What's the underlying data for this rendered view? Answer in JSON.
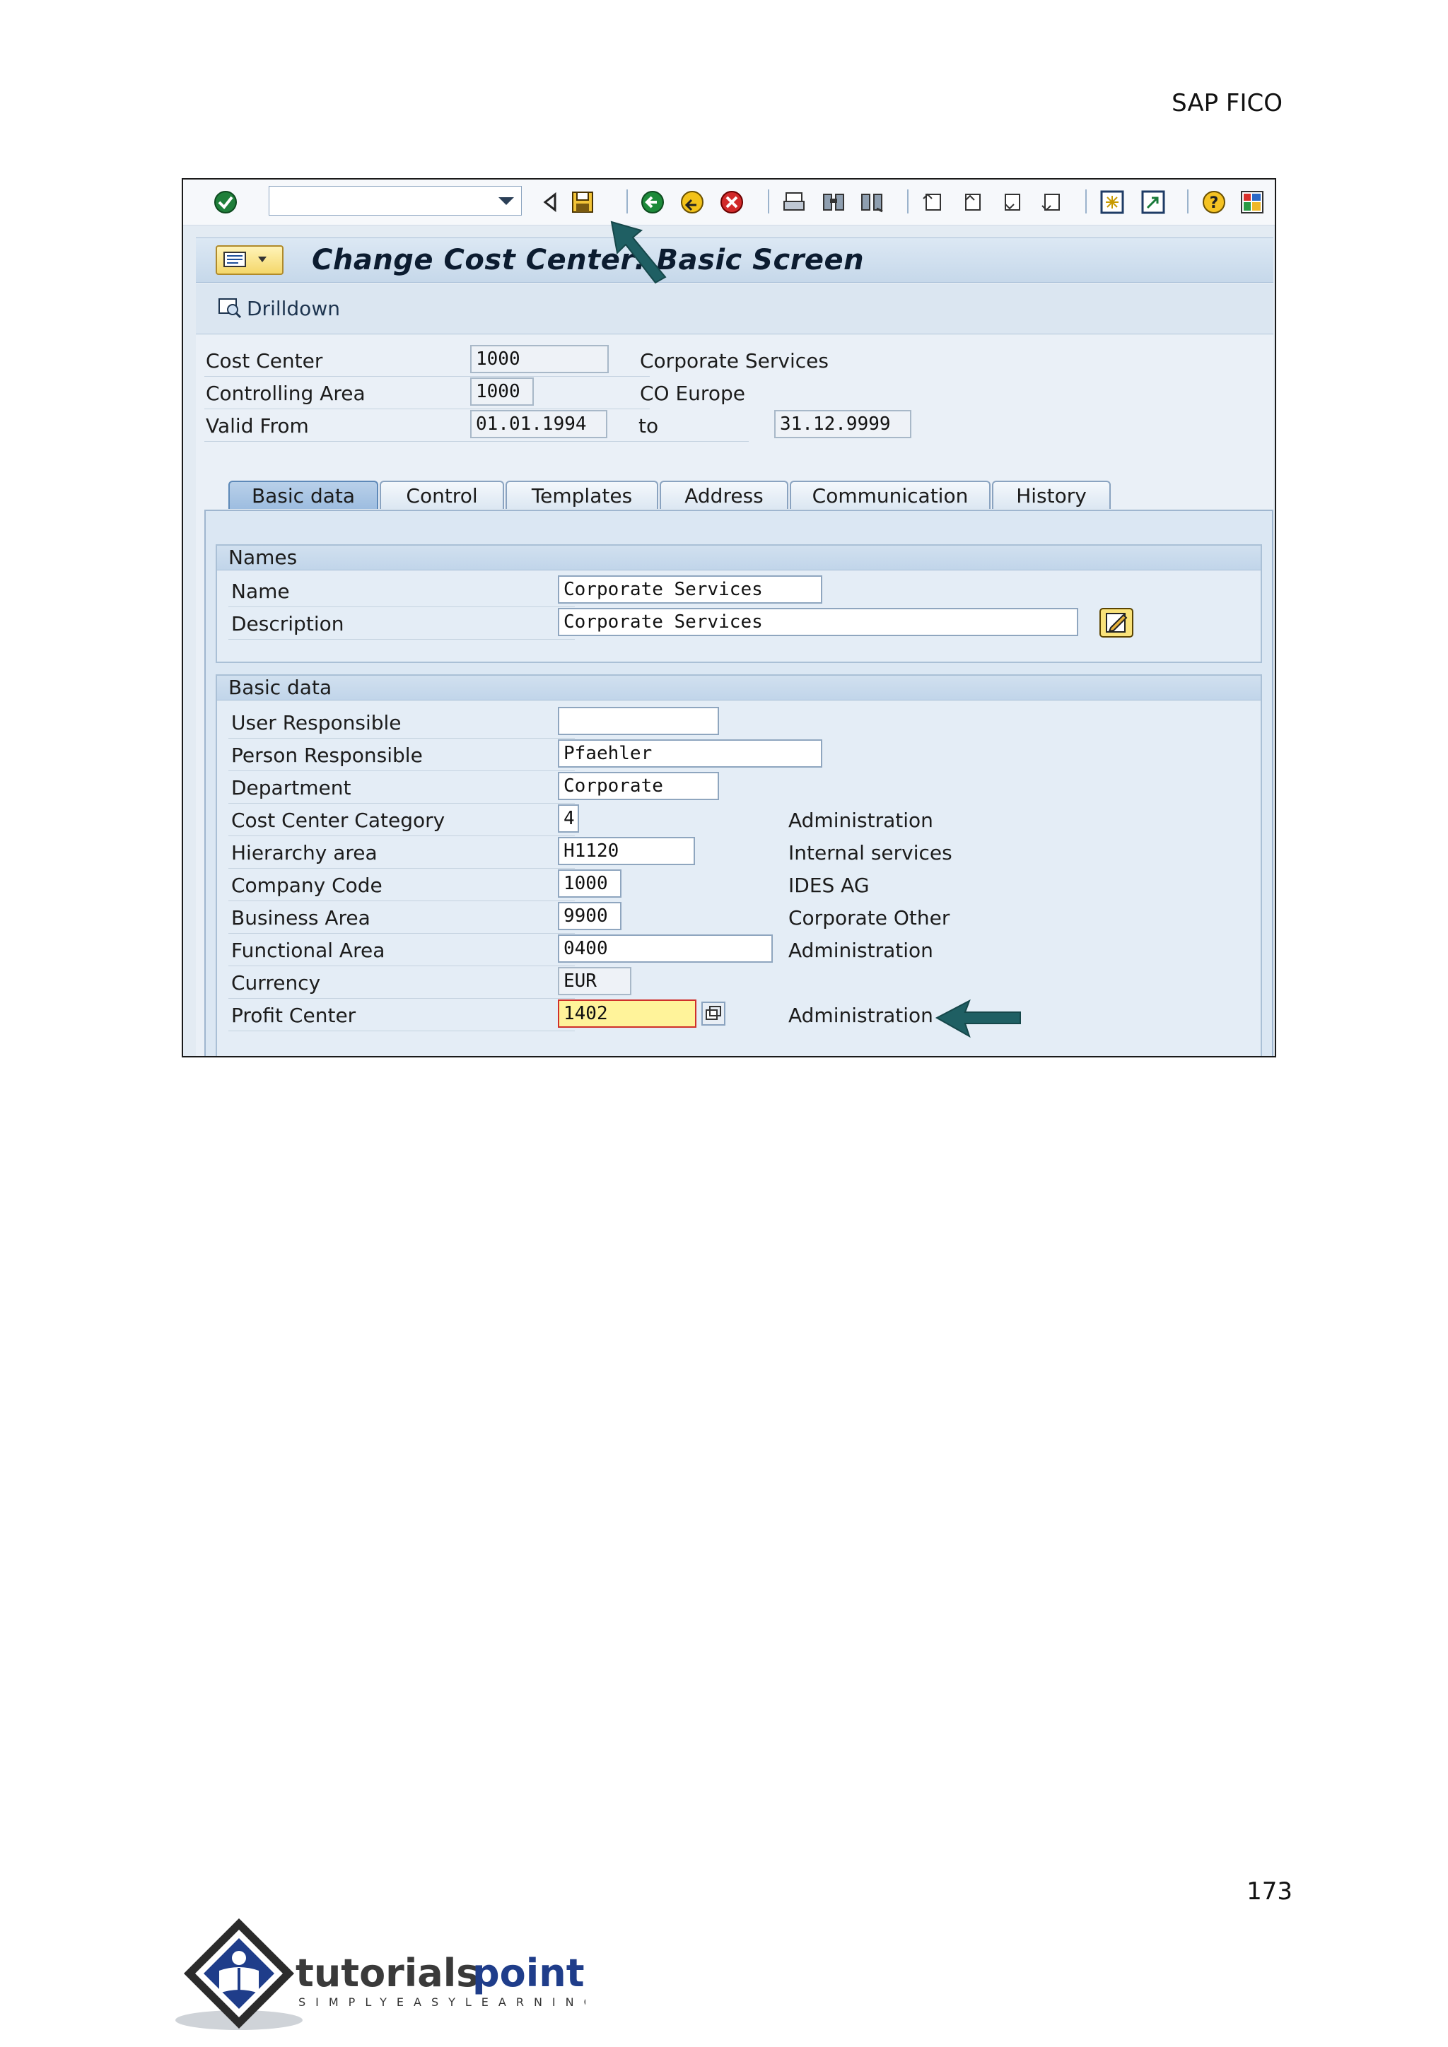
{
  "page": {
    "header_right": "SAP FICO",
    "page_number": "173"
  },
  "toolbar": {
    "command_field_value": "",
    "icons": [
      "enter-icon",
      "back-triangle-icon",
      "save-icon",
      "back-icon",
      "exit-icon",
      "cancel-icon",
      "print-icon",
      "find-icon",
      "find-next-icon",
      "first-page-icon",
      "previous-page-icon",
      "next-page-icon",
      "last-page-icon",
      "new-session-icon",
      "shortcut-icon",
      "help-icon",
      "layout-menu-icon"
    ]
  },
  "title_bar": {
    "title": "Change Cost Center: Basic Screen"
  },
  "app_toolbar": {
    "drilldown_label": "Drilldown"
  },
  "header_fields": {
    "cost_center_label": "Cost Center",
    "cost_center_value": "1000",
    "cost_center_text": "Corporate Services",
    "controlling_area_label": "Controlling Area",
    "controlling_area_value": "1000",
    "controlling_area_text": "CO Europe",
    "valid_from_label": "Valid From",
    "valid_from_value": "01.01.1994",
    "to_label": "to",
    "valid_to_value": "31.12.9999"
  },
  "tabs": [
    {
      "label": "Basic data",
      "active": true
    },
    {
      "label": "Control",
      "active": false
    },
    {
      "label": "Templates",
      "active": false
    },
    {
      "label": "Address",
      "active": false
    },
    {
      "label": "Communication",
      "active": false
    },
    {
      "label": "History",
      "active": false
    }
  ],
  "names_group": {
    "title": "Names",
    "name_label": "Name",
    "name_value": "Corporate Services",
    "description_label": "Description",
    "description_value": "Corporate Services"
  },
  "basic_group": {
    "title": "Basic data",
    "rows": [
      {
        "label": "User Responsible",
        "value": "",
        "text": ""
      },
      {
        "label": "Person Responsible",
        "value": "Pfaehler",
        "text": ""
      },
      {
        "label": "Department",
        "value": "Corporate",
        "text": ""
      },
      {
        "label": "Cost Center Category",
        "value": "4",
        "text": "Administration"
      },
      {
        "label": "Hierarchy area",
        "value": "H1120",
        "text": "Internal services"
      },
      {
        "label": "Company Code",
        "value": "1000",
        "text": "IDES AG"
      },
      {
        "label": "Business Area",
        "value": "9900",
        "text": "Corporate Other"
      },
      {
        "label": "Functional Area",
        "value": "0400",
        "text": "Administration"
      },
      {
        "label": "Currency",
        "value": "EUR",
        "text": ""
      },
      {
        "label": "Profit Center",
        "value": "1402",
        "text": "Administration"
      }
    ]
  },
  "colors": {
    "annotation_arrow": "#1f5f63",
    "active_field": "#fff39a",
    "active_field_border": "#d0302a"
  },
  "logo": {
    "name": "tutorialspoint",
    "tagline": "SIMPLYEASYLEARNING"
  }
}
